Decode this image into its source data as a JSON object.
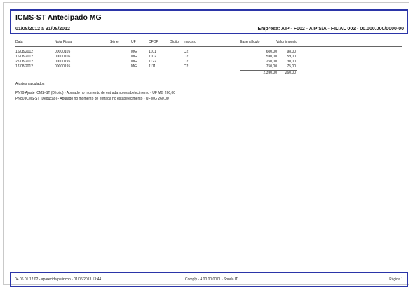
{
  "report": {
    "title": "ICMS-ST Antecipado MG",
    "period": "01/08/2012 a 31/08/2012",
    "company": "Empresa: AIP - F002 - AIP S/A - FILIAL 002 - 00.000.000/0000-00"
  },
  "table": {
    "headers": {
      "data": "Data",
      "nota_fiscal": "Nota Fiscal",
      "serie": "Série",
      "uf": "UF",
      "cfop": "CFOP",
      "digito": "Dígito",
      "imposto": "Imposto",
      "base_calculo": "Base cálculo",
      "valor_imposto": "Valor imposto"
    },
    "rows": [
      {
        "data": "16/08/2012",
        "nota_fiscal": "00000105",
        "serie": "",
        "uf": "MG",
        "cfop": "1101",
        "digito": "",
        "imposto": "C2",
        "base_calculo": "600,00",
        "valor_imposto": "98,00"
      },
      {
        "data": "16/08/2012",
        "nota_fiscal": "00000106",
        "serie": "",
        "uf": "MG",
        "cfop": "1102",
        "digito": "",
        "imposto": "C2",
        "base_calculo": "590,00",
        "valor_imposto": "59,00"
      },
      {
        "data": "27/08/2012",
        "nota_fiscal": "00000195",
        "serie": "",
        "uf": "MG",
        "cfop": "1122",
        "digito": "",
        "imposto": "C2",
        "base_calculo": "250,00",
        "valor_imposto": "30,00"
      },
      {
        "data": "17/08/2012",
        "nota_fiscal": "00000195",
        "serie": "",
        "uf": "MG",
        "cfop": "1111",
        "digito": "",
        "imposto": "C2",
        "base_calculo": "750,00",
        "valor_imposto": "75,00"
      }
    ],
    "totals": {
      "base_calculo": "2.390,00",
      "valor_imposto": "260,00"
    }
  },
  "adjustments": {
    "title": "Ajustes calculados",
    "items": [
      "PN79  Ajuste ICMS-ST (Débito) - Apurado no momento de entrada no estabelecimento - UF MG  260,00",
      "PN80  ICMS-ST (Dedução) - Apurado no momento de entrada no estabelecimento - UF MG  260,00"
    ]
  },
  "footer": {
    "left": "04.06.01.12.02 - aparecida.pelincon - 01/06/2013 13:44",
    "center": "Comply - 4.00.00.0071 - Sonda IT",
    "right": "Página 1"
  }
}
